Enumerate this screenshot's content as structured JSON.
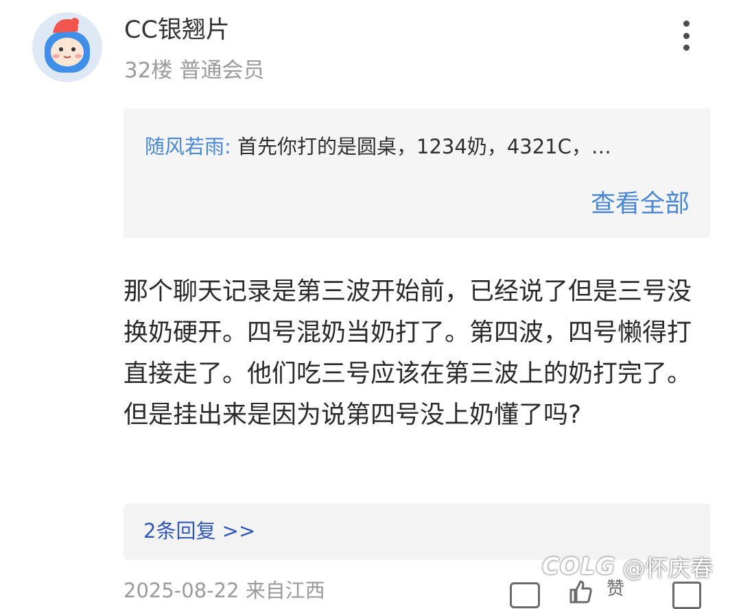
{
  "post": {
    "username": "CC银翘片",
    "floor": "32楼",
    "member_level": "普通会员",
    "more_icon": "more-vertical-icon",
    "quote": {
      "author": "随风若雨:",
      "text": "首先你打的是圆桌，1234奶，4321C，…",
      "view_all": "查看全部"
    },
    "content": "那个聊天记录是第三波开始前，已经说了但是三号没换奶硬开。四号混奶当奶打了。第四波，四号懒得打直接走了。他们吃三号应该在第三波上的奶打完了。但是挂出来是因为说第四号没上奶懂了吗?",
    "replies_link": "2条回复 >>",
    "footer": {
      "meta": "2025-08-22 来自江西",
      "like_label": "赞"
    }
  },
  "watermark": {
    "logo": "COLG",
    "handle": "@怀庆春"
  },
  "colors": {
    "link_blue": "#4a86d6",
    "reply_blue": "#2f57b8",
    "quote_bg": "#f5f5f5"
  }
}
